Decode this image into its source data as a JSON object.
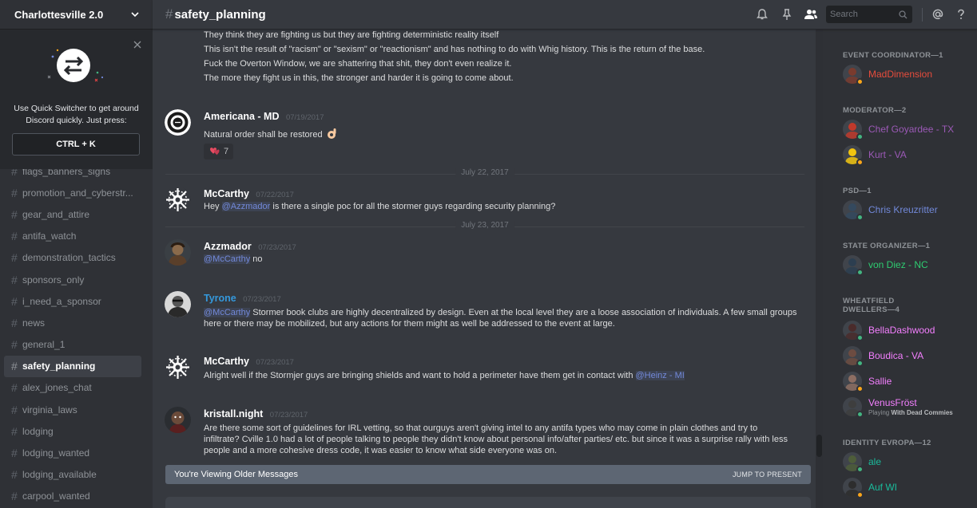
{
  "server": {
    "name": "Charlottesville 2.0"
  },
  "quick_switcher": {
    "text": "Use Quick Switcher to get around Discord quickly. Just press:",
    "shortcut": "CTRL + K"
  },
  "channels": [
    {
      "name": "flags_banners_signs"
    },
    {
      "name": "promotion_and_cyberstr..."
    },
    {
      "name": "gear_and_attire"
    },
    {
      "name": "antifa_watch"
    },
    {
      "name": "demonstration_tactics"
    },
    {
      "name": "sponsors_only"
    },
    {
      "name": "i_need_a_sponsor"
    },
    {
      "name": "news"
    },
    {
      "name": "general_1"
    },
    {
      "name": "safety_planning"
    },
    {
      "name": "alex_jones_chat"
    },
    {
      "name": "virginia_laws"
    },
    {
      "name": "lodging"
    },
    {
      "name": "lodging_wanted"
    },
    {
      "name": "lodging_available"
    },
    {
      "name": "carpool_wanted"
    }
  ],
  "header": {
    "hash": "#",
    "channel": "safety_planning",
    "search_placeholder": "Search",
    "icons": [
      "bell-icon",
      "pin-icon",
      "members-icon",
      "search-icon",
      "at-icon",
      "help-icon"
    ]
  },
  "continuation": [
    "They think they are fighting us but they are fighting deterministic reality itself",
    "This isn't the result of \"racism\" or \"sexism\" or \"reactionism\" and has nothing to do with Whig history.  This is the return of the base.",
    "Fuck the Overton Window, we are shattering that shit, they don't even realize it.",
    "The more they fight us in this, the stronger and harder it is going to come about."
  ],
  "messages": [
    {
      "author": "Americana - MD",
      "timestamp": "07/19/2017",
      "text": "Natural order shall be restored",
      "emoji": "ok-hand",
      "reaction": {
        "emoji": "heart-eyes",
        "count": "7"
      }
    },
    {
      "divider": "July 22, 2017"
    },
    {
      "author": "McCarthy",
      "timestamp": "07/22/2017",
      "pre": "Hey ",
      "mention": "@Azzmador",
      "post": " is there a single poc for all the stormer guys regarding security planning?"
    },
    {
      "divider": "July 23, 2017"
    },
    {
      "author": "Azzmador",
      "timestamp": "07/23/2017",
      "pre": "",
      "mention": "@McCarthy",
      "post": " no"
    },
    {
      "author": "Tyrone",
      "author_color": "#3498db",
      "timestamp": "07/23/2017",
      "mention": "@McCarthy",
      "post": " Stormer book clubs are highly decentralized by design. Even at the local level they are a loose association of individuals.  A few small groups here or there may be mobilized, but any actions for them might as well be addressed to the event at large."
    },
    {
      "author": "McCarthy",
      "timestamp": "07/23/2017",
      "pre": "Alright well if the Stormjer guys are bringing shields and want to hold a perimeter have them get in contact with ",
      "mention": "@Heinz - MI",
      "post": ""
    },
    {
      "author": "kristall.night",
      "timestamp": "07/23/2017",
      "text": "Are there some sort of guidelines for IRL vetting, so that ourguys aren't giving intel to any antifa types who may come in plain clothes and try to infiltrate? Cville 1.0 had a lot of people talking to people they didn't know about personal info/after parties/ etc. but since it was a surprise rally with less people and a more cohesive dress code, it was easier to know what side everyone was on."
    }
  ],
  "older_bar": {
    "left": "You're Viewing Older Messages",
    "right": "JUMP TO PRESENT"
  },
  "members": {
    "roles": [
      {
        "title": "EVENT COORDINATOR—1",
        "members": [
          {
            "name": "MadDimension",
            "color": "#e74c3c",
            "status": "#faa61a"
          }
        ]
      },
      {
        "title": "MODERATOR—2",
        "members": [
          {
            "name": "Chef Goyardee - TX",
            "color": "#9b59b6",
            "status": "#43b581"
          },
          {
            "name": "Kurt - VA",
            "color": "#9b59b6",
            "status": "#faa61a"
          }
        ]
      },
      {
        "title": "PSD—1",
        "members": [
          {
            "name": "Chris Kreuzritter",
            "color": "#7289da",
            "status": "#43b581"
          }
        ]
      },
      {
        "title": "STATE ORGANIZER—1",
        "members": [
          {
            "name": "von Diez - NC",
            "color": "#2ecc71",
            "status": "#43b581"
          }
        ]
      },
      {
        "title": "WHEATFIELD DWELLERS—4",
        "members": [
          {
            "name": "BellaDashwood",
            "color": "#f47fff",
            "status": "#43b581"
          },
          {
            "name": "Boudica - VA",
            "color": "#f47fff",
            "status": "#43b581"
          },
          {
            "name": "Sallie",
            "color": "#f47fff",
            "status": "#faa61a"
          },
          {
            "name": "VenusFröst",
            "color": "#f47fff",
            "status": "#43b581",
            "activity_prefix": "Playing ",
            "activity": "With Dead Commies"
          }
        ]
      },
      {
        "title": "IDENTITY EVROPA—12",
        "members": [
          {
            "name": "ale",
            "color": "#1abc9c",
            "status": "#43b581"
          },
          {
            "name": "Auf WI",
            "color": "#1abc9c",
            "status": "#faa61a"
          }
        ]
      }
    ]
  }
}
